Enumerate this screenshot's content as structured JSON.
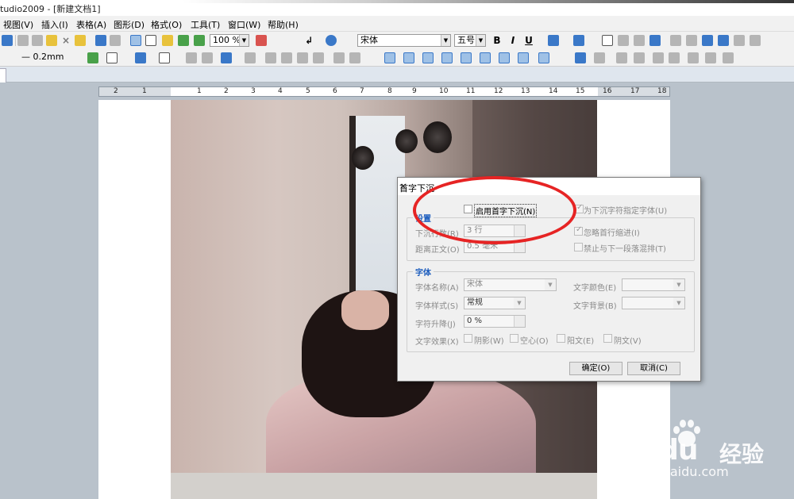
{
  "window": {
    "title": "tudio2009 - [新建文档1]"
  },
  "menu": [
    "视图(V)",
    "插入(I)",
    "表格(A)",
    "图形(D)",
    "格式(O)",
    "工具(T)",
    "窗口(W)",
    "帮助(H)"
  ],
  "toolbar": {
    "zoom": "100 %",
    "font_name": "宋体",
    "font_size": "五号",
    "line_width": "— 0.2mm",
    "bold": "B",
    "italic": "I",
    "underline": "U"
  },
  "ruler": {
    "labels": [
      "2",
      "1",
      "1",
      "2",
      "3",
      "4",
      "5",
      "6",
      "7",
      "8",
      "9",
      "10",
      "11",
      "12",
      "13",
      "14",
      "15",
      "16",
      "17",
      "18"
    ]
  },
  "dialog": {
    "title": "首字下沉",
    "enable": {
      "label": "启用首字下沉(N)",
      "checked": false
    },
    "assign_font": {
      "label": "为下沉字符指定字体(U)",
      "checked": true
    },
    "settings_group": "设置",
    "lines_label": "下沉行数(R)",
    "lines_value": "3 行",
    "distance_label": "距离正文(O)",
    "distance_value": "0.5 毫米",
    "ignore_indent": {
      "label": "忽略首行缩进(I)",
      "checked": true
    },
    "no_mix": {
      "label": "禁止与下一段落混排(T)",
      "checked": false
    },
    "font_group": "字体",
    "font_name_label": "字体名称(A)",
    "font_name_value": "宋体",
    "font_style_label": "字体样式(S)",
    "font_style_value": "常规",
    "text_color_label": "文字颜色(E)",
    "text_bg_label": "文字背景(B)",
    "raise_label": "字符升降(J)",
    "raise_value": "0 %",
    "effects_label": "文字效果(X)",
    "effects": [
      "阴影(W)",
      "空心(O)",
      "阳文(E)",
      "阴文(V)"
    ],
    "ok_label": "确定(O)",
    "cancel_label": "取消(C)"
  },
  "watermark": {
    "brand": "Baidu",
    "brand_cn": "经验",
    "url": "jingyan.baidu.com"
  },
  "colors": {
    "accent_red": "#e62424",
    "group_blue": "#1a5bbd"
  }
}
